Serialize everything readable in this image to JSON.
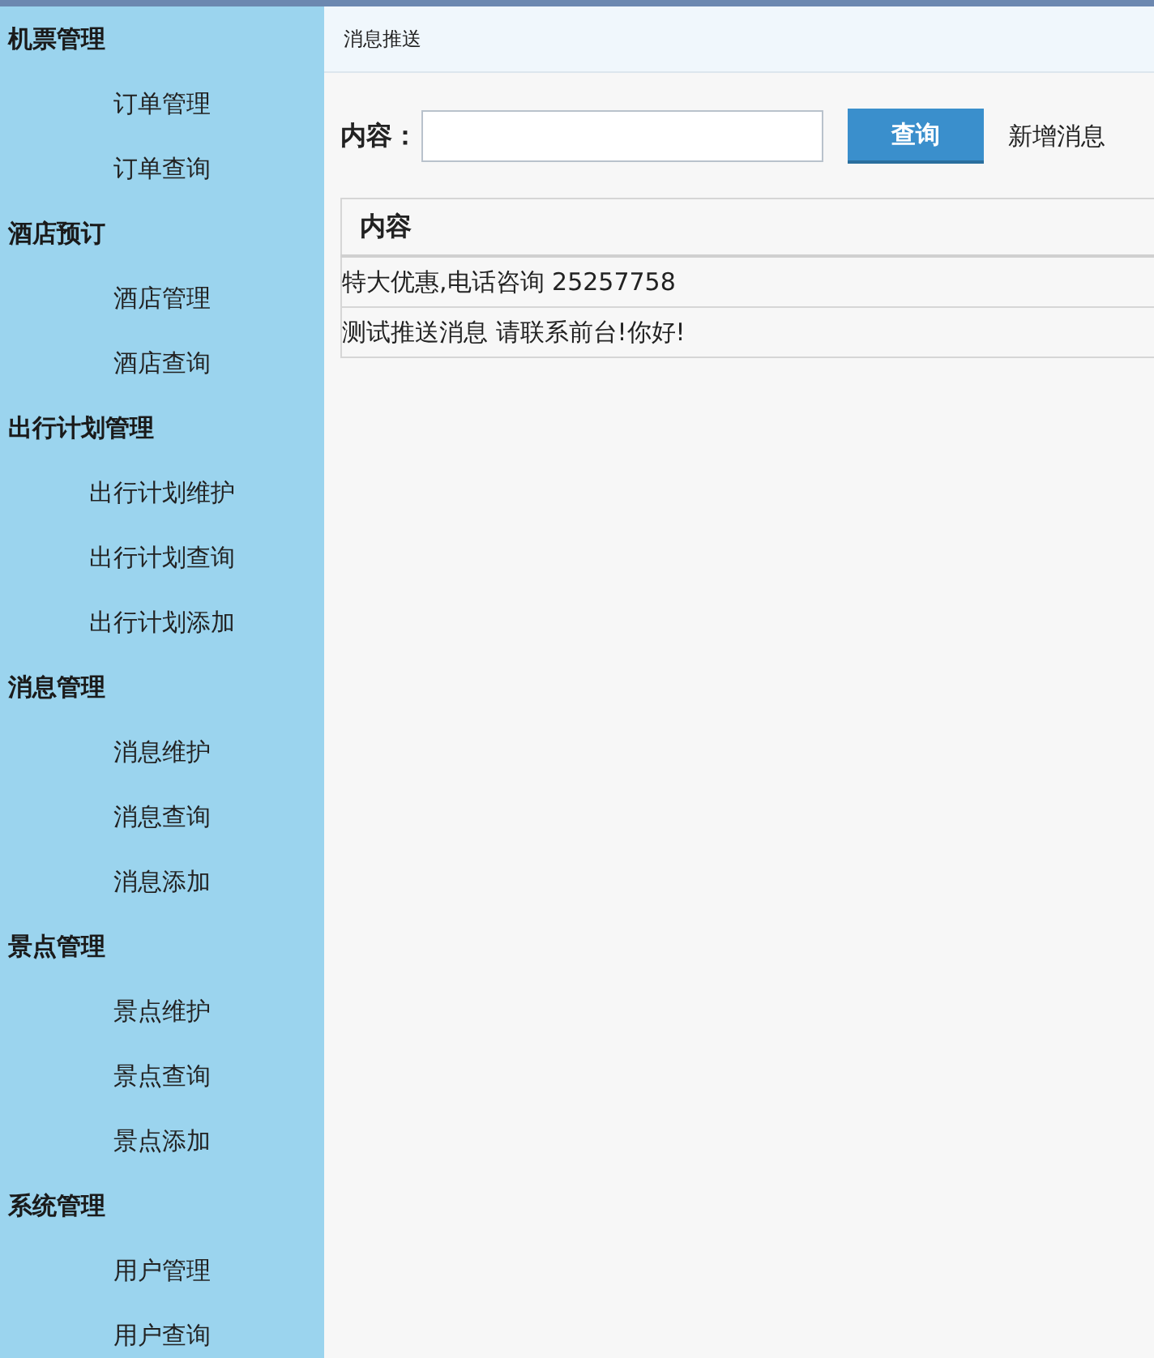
{
  "sidebar": {
    "groups": [
      {
        "title": "机票管理",
        "items": [
          "订单管理",
          "订单查询"
        ]
      },
      {
        "title": "酒店预订",
        "items": [
          "酒店管理",
          "酒店查询"
        ]
      },
      {
        "title": "出行计划管理",
        "items": [
          "出行计划维护",
          "出行计划查询",
          "出行计划添加"
        ]
      },
      {
        "title": "消息管理",
        "items": [
          "消息维护",
          "消息查询",
          "消息添加"
        ]
      },
      {
        "title": "景点管理",
        "items": [
          "景点维护",
          "景点查询",
          "景点添加"
        ]
      },
      {
        "title": "系统管理",
        "items": [
          "用户管理",
          "用户查询"
        ]
      }
    ]
  },
  "page": {
    "title": "消息推送",
    "search": {
      "label": "内容：",
      "button": "查询",
      "add_link": "新增消息"
    },
    "table": {
      "columns": [
        "内容"
      ],
      "rows": [
        [
          "特大优惠,电话咨询 25257758"
        ],
        [
          "测试推送消息 请联系前台!你好!"
        ]
      ]
    }
  }
}
